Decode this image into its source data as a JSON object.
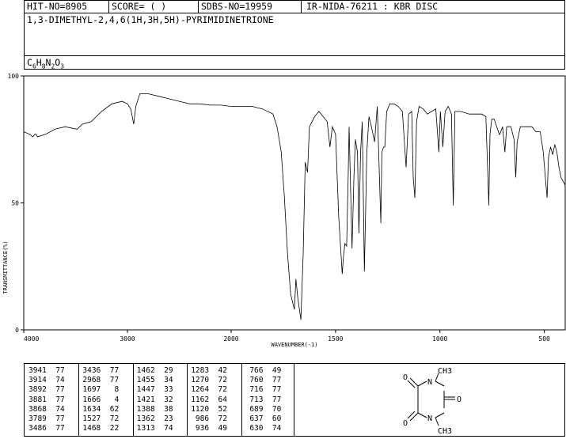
{
  "header": {
    "hit_no": "HIT-NO=8905",
    "score": "SCORE=  (   )",
    "sdbs_no": "SDBS-NO=19959",
    "ir_source": "IR-NIDA-76211 : KBR DISC"
  },
  "compound_name": "1,3-DIMETHYL-2,4,6(1H,3H,5H)-PYRIMIDINETRIONE",
  "formula": {
    "c": "C",
    "c_n": "6",
    "h": "H",
    "h_n": "8",
    "n": "N",
    "n_n": "2",
    "o": "O",
    "o_n": "3"
  },
  "chart_data": {
    "type": "line",
    "xlabel": "WAVENUMBER(-1)",
    "ylabel": "TRANSMITTANCE(%)",
    "xlim": [
      4000,
      400
    ],
    "ylim": [
      0,
      100
    ],
    "x_ticks": [
      "4000",
      "3000",
      "2000",
      "1500",
      "1000",
      "500"
    ],
    "y_ticks": [
      "100",
      "50",
      "0"
    ],
    "series": [
      {
        "points": [
          [
            4000,
            78
          ],
          [
            3941,
            77
          ],
          [
            3914,
            76
          ],
          [
            3892,
            77
          ],
          [
            3881,
            77
          ],
          [
            3868,
            76
          ],
          [
            3789,
            77
          ],
          [
            3700,
            79
          ],
          [
            3600,
            80
          ],
          [
            3486,
            79
          ],
          [
            3436,
            81
          ],
          [
            3350,
            82
          ],
          [
            3250,
            86
          ],
          [
            3150,
            89
          ],
          [
            3050,
            90
          ],
          [
            3000,
            89
          ],
          [
            2968,
            87
          ],
          [
            2940,
            81
          ],
          [
            2920,
            88
          ],
          [
            2880,
            93
          ],
          [
            2800,
            93
          ],
          [
            2700,
            92
          ],
          [
            2600,
            91
          ],
          [
            2500,
            90
          ],
          [
            2400,
            89
          ],
          [
            2300,
            89
          ],
          [
            2200,
            88.5
          ],
          [
            2100,
            88.5
          ],
          [
            2000,
            88
          ],
          [
            1900,
            88
          ],
          [
            1850,
            87
          ],
          [
            1800,
            85
          ],
          [
            1780,
            80
          ],
          [
            1760,
            70
          ],
          [
            1745,
            52
          ],
          [
            1730,
            30
          ],
          [
            1715,
            14
          ],
          [
            1697,
            8
          ],
          [
            1690,
            20
          ],
          [
            1680,
            12
          ],
          [
            1666,
            4
          ],
          [
            1655,
            30
          ],
          [
            1645,
            66
          ],
          [
            1634,
            62
          ],
          [
            1625,
            80
          ],
          [
            1600,
            84
          ],
          [
            1580,
            86
          ],
          [
            1560,
            84
          ],
          [
            1540,
            82
          ],
          [
            1527,
            72
          ],
          [
            1515,
            80
          ],
          [
            1500,
            77
          ],
          [
            1485,
            45
          ],
          [
            1468,
            22
          ],
          [
            1462,
            29
          ],
          [
            1455,
            34
          ],
          [
            1447,
            33
          ],
          [
            1440,
            58
          ],
          [
            1435,
            80
          ],
          [
            1421,
            32
          ],
          [
            1412,
            60
          ],
          [
            1405,
            75
          ],
          [
            1395,
            70
          ],
          [
            1388,
            38
          ],
          [
            1380,
            70
          ],
          [
            1372,
            82
          ],
          [
            1362,
            23
          ],
          [
            1350,
            70
          ],
          [
            1340,
            84
          ],
          [
            1328,
            80
          ],
          [
            1313,
            74
          ],
          [
            1300,
            88
          ],
          [
            1283,
            42
          ],
          [
            1278,
            70
          ],
          [
            1270,
            72
          ],
          [
            1264,
            72
          ],
          [
            1255,
            86
          ],
          [
            1240,
            89
          ],
          [
            1220,
            89
          ],
          [
            1200,
            88
          ],
          [
            1180,
            86
          ],
          [
            1162,
            64
          ],
          [
            1150,
            85
          ],
          [
            1135,
            86
          ],
          [
            1128,
            60
          ],
          [
            1120,
            52
          ],
          [
            1112,
            82
          ],
          [
            1100,
            88
          ],
          [
            1080,
            87
          ],
          [
            1060,
            85
          ],
          [
            1040,
            86
          ],
          [
            1020,
            87
          ],
          [
            1005,
            70
          ],
          [
            998,
            86
          ],
          [
            986,
            72
          ],
          [
            975,
            86
          ],
          [
            960,
            88
          ],
          [
            945,
            85
          ],
          [
            936,
            49
          ],
          [
            928,
            86
          ],
          [
            900,
            86
          ],
          [
            860,
            85
          ],
          [
            820,
            85
          ],
          [
            800,
            85
          ],
          [
            780,
            84
          ],
          [
            766,
            49
          ],
          [
            760,
            77
          ],
          [
            752,
            83
          ],
          [
            740,
            83
          ],
          [
            716,
            77
          ],
          [
            713,
            77
          ],
          [
            700,
            80
          ],
          [
            689,
            70
          ],
          [
            680,
            80
          ],
          [
            660,
            80
          ],
          [
            645,
            75
          ],
          [
            637,
            60
          ],
          [
            630,
            74
          ],
          [
            615,
            80
          ],
          [
            590,
            80
          ],
          [
            560,
            80
          ],
          [
            540,
            78
          ],
          [
            520,
            78
          ],
          [
            505,
            70
          ],
          [
            495,
            60
          ],
          [
            487,
            52
          ],
          [
            480,
            68
          ],
          [
            470,
            72
          ],
          [
            460,
            69
          ],
          [
            450,
            73
          ],
          [
            440,
            70
          ],
          [
            430,
            64
          ],
          [
            420,
            60
          ],
          [
            400,
            57
          ]
        ]
      }
    ]
  },
  "peak_table": [
    [
      [
        "3941",
        "77"
      ],
      [
        "3914",
        "74"
      ],
      [
        "3892",
        "77"
      ],
      [
        "3881",
        "77"
      ],
      [
        "3868",
        "74"
      ],
      [
        "3789",
        "77"
      ],
      [
        "3486",
        "77"
      ]
    ],
    [
      [
        "3436",
        "77"
      ],
      [
        "2968",
        "77"
      ],
      [
        "1697",
        "8"
      ],
      [
        "1666",
        "4"
      ],
      [
        "1634",
        "62"
      ],
      [
        "1527",
        "72"
      ],
      [
        "1468",
        "22"
      ]
    ],
    [
      [
        "1462",
        "29"
      ],
      [
        "1455",
        "34"
      ],
      [
        "1447",
        "33"
      ],
      [
        "1421",
        "32"
      ],
      [
        "1388",
        "38"
      ],
      [
        "1362",
        "23"
      ],
      [
        "1313",
        "74"
      ]
    ],
    [
      [
        "1283",
        "42"
      ],
      [
        "1270",
        "72"
      ],
      [
        "1264",
        "72"
      ],
      [
        "1162",
        "64"
      ],
      [
        "1120",
        "52"
      ],
      [
        "986",
        "72"
      ],
      [
        "936",
        "49"
      ]
    ],
    [
      [
        "766",
        "49"
      ],
      [
        "760",
        "77"
      ],
      [
        "716",
        "77"
      ],
      [
        "713",
        "77"
      ],
      [
        "689",
        "70"
      ],
      [
        "637",
        "60"
      ],
      [
        "630",
        "74"
      ]
    ]
  ],
  "structure": {
    "atoms": {
      "o_top": "O",
      "n1": "N",
      "ch3_top": "CH3",
      "o_right": "O",
      "n3": "N",
      "o_bottom": "O",
      "ch3_bottom": "CH3"
    }
  }
}
